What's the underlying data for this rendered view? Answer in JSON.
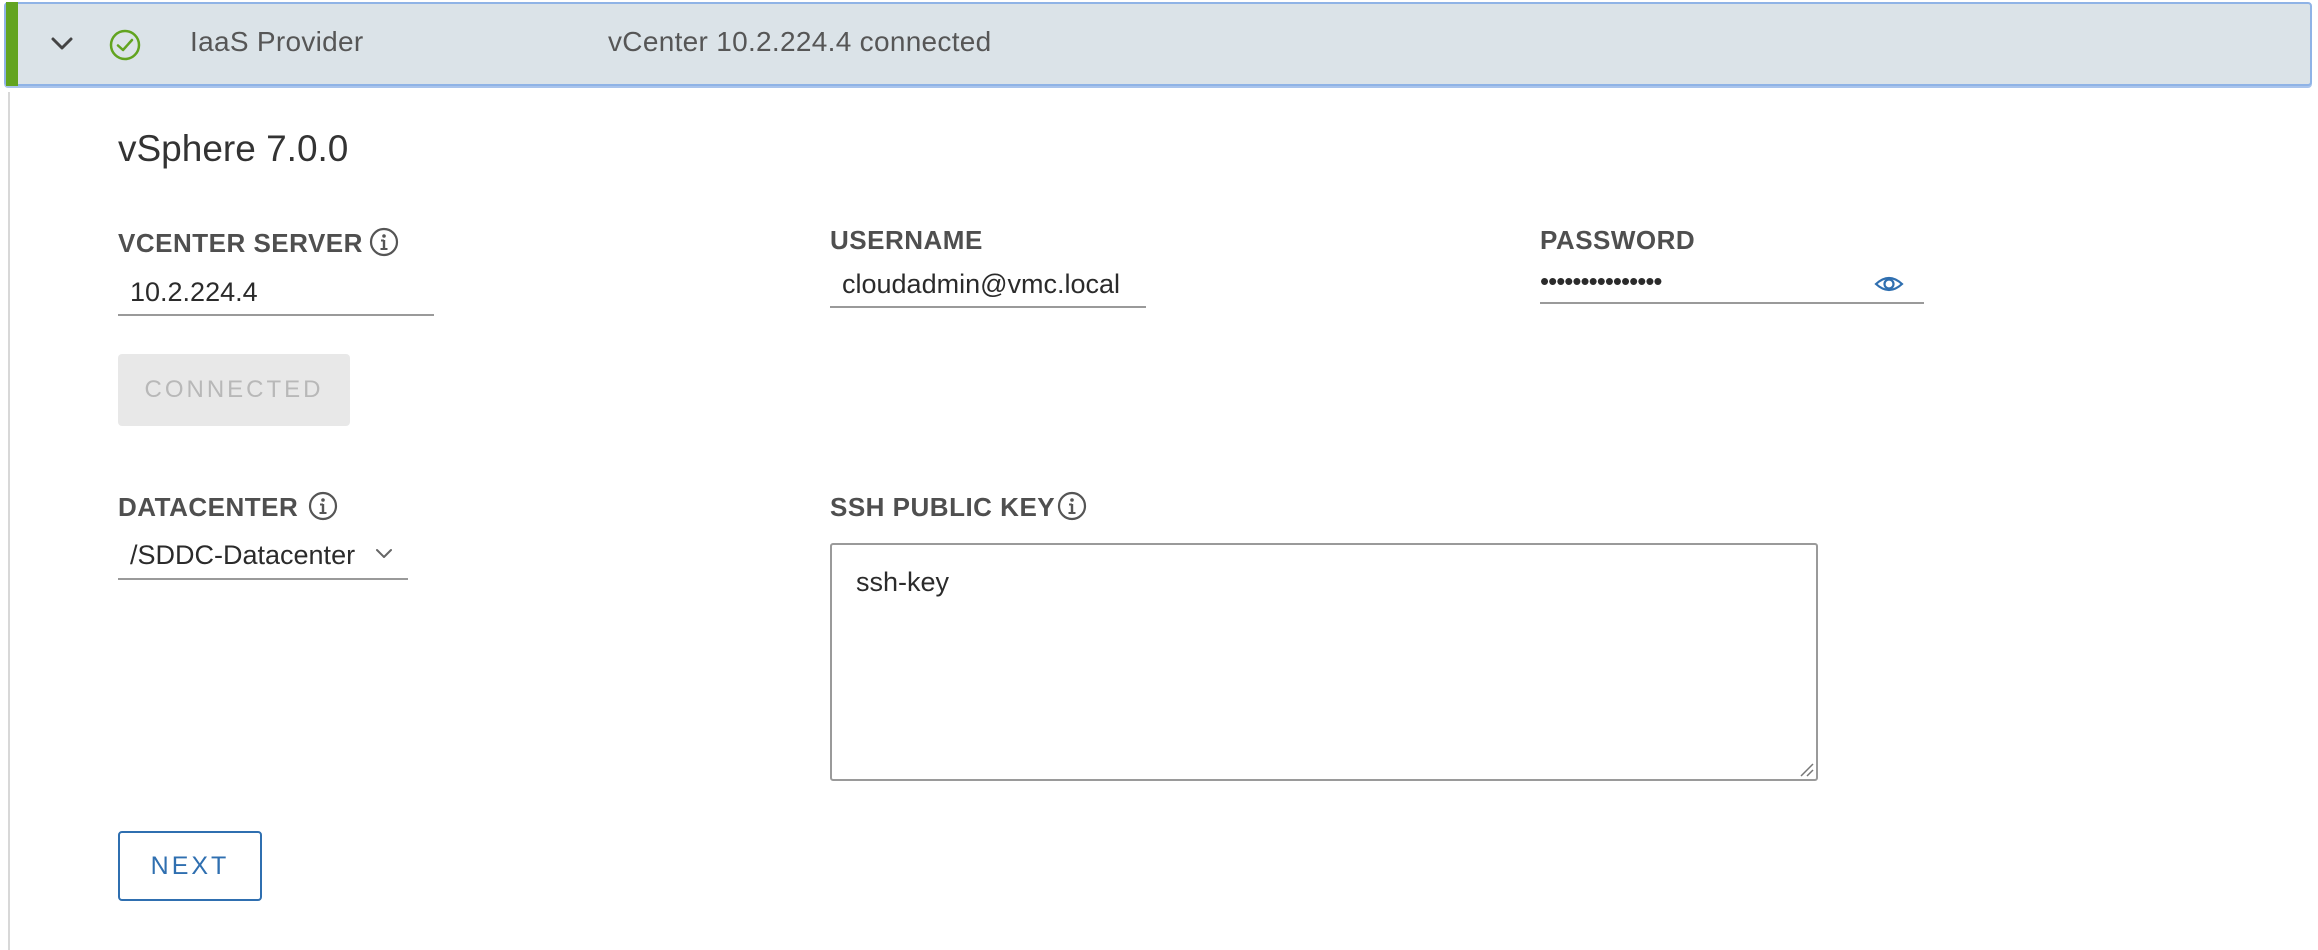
{
  "header": {
    "provider_title": "IaaS Provider",
    "status_text": "vCenter 10.2.224.4 connected",
    "accent_color": "#62a420",
    "chevron_icon": "chevron-down-icon",
    "status_icon": "check-circle-icon"
  },
  "section": {
    "title": "vSphere 7.0.0"
  },
  "vcenter": {
    "label": "VCENTER SERVER",
    "value": "10.2.224.4",
    "info_icon": "info-circle-icon"
  },
  "username": {
    "label": "USERNAME",
    "value": "cloudadmin@vmc.local"
  },
  "password": {
    "label": "PASSWORD",
    "masked_value": "•••••••••••••••",
    "reveal_icon": "eye-icon"
  },
  "connect_button": {
    "label": "CONNECTED",
    "state": "disabled"
  },
  "datacenter": {
    "label": "DATACENTER",
    "selected": "/SDDC-Datacenter",
    "info_icon": "info-circle-icon"
  },
  "ssh_key": {
    "label": "SSH PUBLIC KEY",
    "value": "ssh-key",
    "info_icon": "info-circle-icon"
  },
  "next_button": {
    "label": "NEXT",
    "color": "#2f6fb0"
  }
}
